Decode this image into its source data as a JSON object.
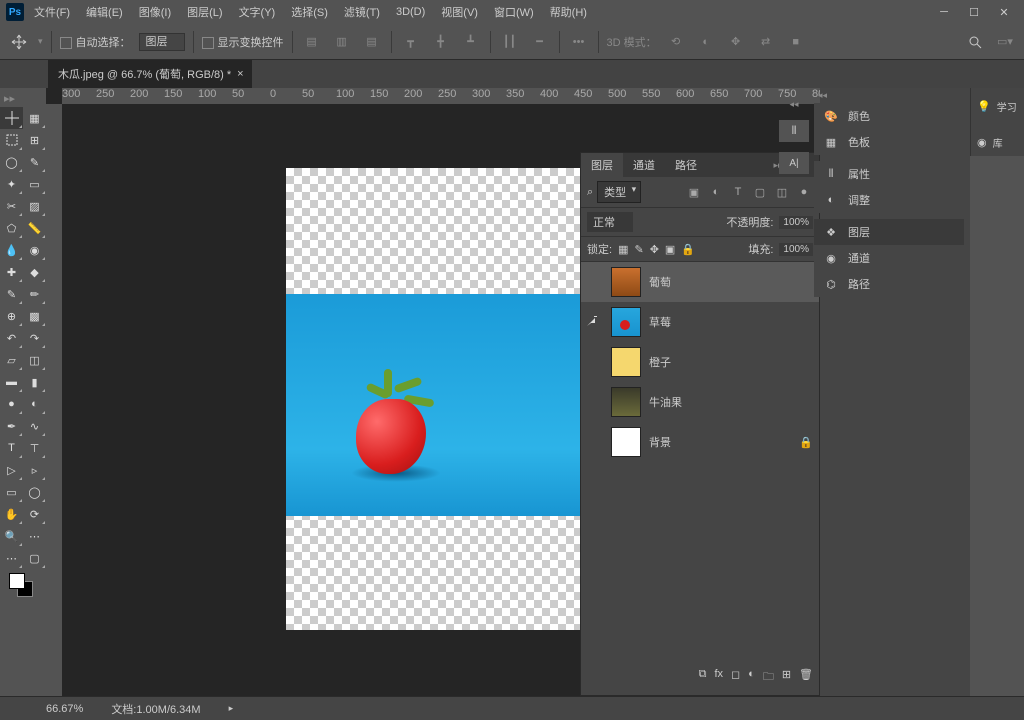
{
  "menu": {
    "items": [
      "文件(F)",
      "编辑(E)",
      "图像(I)",
      "图层(L)",
      "文字(Y)",
      "选择(S)",
      "滤镜(T)",
      "3D(D)",
      "视图(V)",
      "窗口(W)",
      "帮助(H)"
    ]
  },
  "optbar": {
    "auto_select": "自动选择：",
    "auto_select_target": "图层",
    "show_transform": "显示变换控件",
    "mode_3d": "3D 模式："
  },
  "tab": {
    "title": "木瓜.jpeg @ 66.7% (葡萄, RGB/8) *"
  },
  "right": {
    "color": "颜色",
    "swatches": "色板",
    "learn": "学习",
    "library": "库",
    "properties": "属性",
    "adjustments": "调整",
    "layers": "图层",
    "channels": "通道",
    "paths": "路径"
  },
  "layerspanel": {
    "tabs": {
      "layers": "图层",
      "channels": "通道",
      "paths": "路径"
    },
    "filter_kind": "类型",
    "blend_mode": "正常",
    "opacity_label": "不透明度:",
    "opacity_val": "100%",
    "lock_label": "锁定:",
    "fill_label": "填充:",
    "fill_val": "100%",
    "layers": [
      {
        "name": "葡萄"
      },
      {
        "name": "草莓"
      },
      {
        "name": "橙子"
      },
      {
        "name": "牛油果"
      },
      {
        "name": "背景"
      }
    ]
  },
  "status": {
    "zoom": "66.67%",
    "doc": "文档:1.00M/6.34M"
  },
  "ruler": [
    "300",
    "250",
    "200",
    "150",
    "100",
    "50",
    "0",
    "50",
    "100",
    "150",
    "200",
    "250",
    "300",
    "350",
    "400",
    "450",
    "500",
    "550",
    "600",
    "650",
    "700",
    "750",
    "80"
  ]
}
